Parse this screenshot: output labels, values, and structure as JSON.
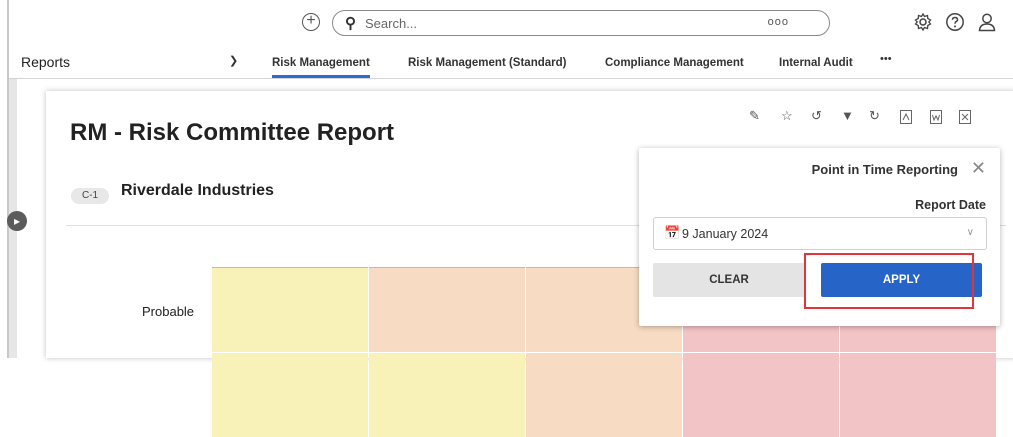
{
  "search": {
    "placeholder": "Search...",
    "more": "ooo"
  },
  "nav": {
    "reports_label": "Reports",
    "tabs": [
      "Risk Management",
      "Risk Management (Standard)",
      "Compliance Management",
      "Internal Audit"
    ],
    "more": "•••"
  },
  "report": {
    "title": "RM - Risk Committee Report",
    "badge": "C-1",
    "company": "Riverdale Industries",
    "row_label": "Probable"
  },
  "popup": {
    "title": "Point in Time Reporting",
    "report_date_label": "Report Date",
    "date_value": "9 January 2024",
    "clear_label": "CLEAR",
    "apply_label": "APPLY"
  },
  "colors": {
    "accent": "#2764c8",
    "highlight": "#e0353b",
    "heat_yellow": "#f8f1b8",
    "heat_orange": "#f7dcc3",
    "heat_red": "#f2c4c6"
  },
  "icons": [
    "plus-circle-icon",
    "search-icon",
    "settings-icon",
    "help-icon",
    "user-icon",
    "chevron-down-icon",
    "pencil-icon",
    "star-icon",
    "history-icon",
    "filter-icon",
    "refresh-icon",
    "pdf-icon",
    "word-icon",
    "excel-icon",
    "close-icon",
    "calendar-icon"
  ]
}
